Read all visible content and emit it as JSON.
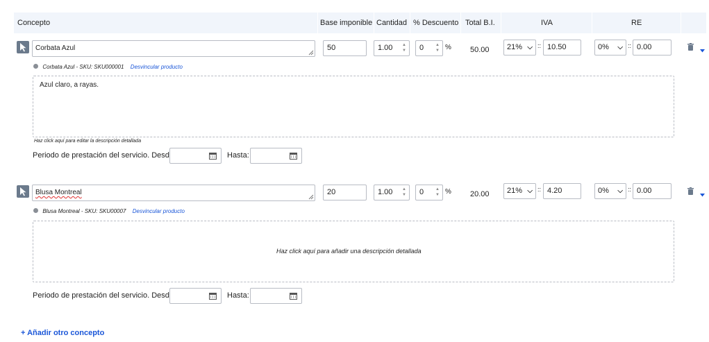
{
  "header": {
    "concepto": "Concepto",
    "base": "Base imponible",
    "cantidad": "Cantidad",
    "descuento": "% Descuento",
    "total": "Total B.I.",
    "iva": "IVA",
    "re": "RE"
  },
  "rows": [
    {
      "concepto": "Corbata Azul",
      "product_ref": "Corbata Azul - SKU: SKU000001",
      "unlink": "Desvincular producto",
      "base": "50",
      "cantidad": "1.00",
      "descuento": "0",
      "percent": "%",
      "total": "50.00",
      "iva_rate": "21%",
      "iva_sep": "::",
      "iva_amount": "10.50",
      "re_rate": "0%",
      "re_sep": "::",
      "re_amount": "0.00",
      "description": "Azul claro, a rayas.",
      "description_hint": "Haz click aquí para editar la descripción detallada",
      "period_label": "Periodo de prestación del servicio. Desde:",
      "until_label": "Hasta:"
    },
    {
      "concepto": "Blusa Montreal",
      "product_ref": "Blusa Montreal - SKU: SKU00007",
      "unlink": "Desvincular producto",
      "base": "20",
      "cantidad": "1.00",
      "descuento": "0",
      "percent": "%",
      "total": "20.00",
      "iva_rate": "21%",
      "iva_sep": "::",
      "iva_amount": "4.20",
      "re_rate": "0%",
      "re_sep": "::",
      "re_amount": "0.00",
      "description_placeholder": "Haz click aquí para añadir una descripción detallada",
      "period_label": "Periodo de prestación del servicio. Desde:",
      "until_label": "Hasta:"
    }
  ],
  "add_concept": "+ Añadir otro concepto",
  "colors": {
    "accent": "#1a56d8",
    "header_bg": "#f1f5fb",
    "button_gray": "#6b7a8c"
  },
  "icons": [
    "cursor-icon",
    "resize-grip-icon",
    "calendar-icon",
    "trash-icon",
    "caret-down-icon",
    "product-icon"
  ]
}
